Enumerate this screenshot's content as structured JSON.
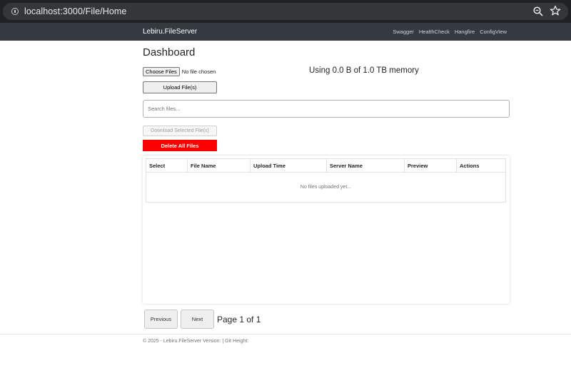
{
  "browser": {
    "url": "localhost:3000/File/Home",
    "icons": [
      "info-icon",
      "zoom-icon",
      "star-icon"
    ]
  },
  "navbar": {
    "brand": "Lebiru.FileServer",
    "links": [
      "Swagger",
      "HealthCheck",
      "Hangfire",
      "ConfigView"
    ]
  },
  "main": {
    "title": "Dashboard",
    "choose_files_label": "Choose Files",
    "no_file_text": "No file chosen",
    "memory_text": "Using 0.0 B of 1.0 TB memory",
    "upload_label": "Upload File(s)",
    "search_placeholder": "Search files...",
    "download_selected_label": "Download Selected File(s)",
    "delete_all_label": "Delete All Files"
  },
  "table": {
    "columns": [
      "Select",
      "File Name",
      "Upload Time",
      "Server Name",
      "Preview",
      "Actions"
    ],
    "empty_text": "No files uploaded yet..."
  },
  "pagination": {
    "previous_label": "Previous",
    "next_label": "Next",
    "page_info": "Page 1 of 1"
  },
  "footer": {
    "text": "© 2025 - Lebiru.FileServer Version: | Git Height:"
  },
  "colors": {
    "navbar": "#343a40",
    "delete": "#ff0000",
    "chrome": "#202124"
  }
}
